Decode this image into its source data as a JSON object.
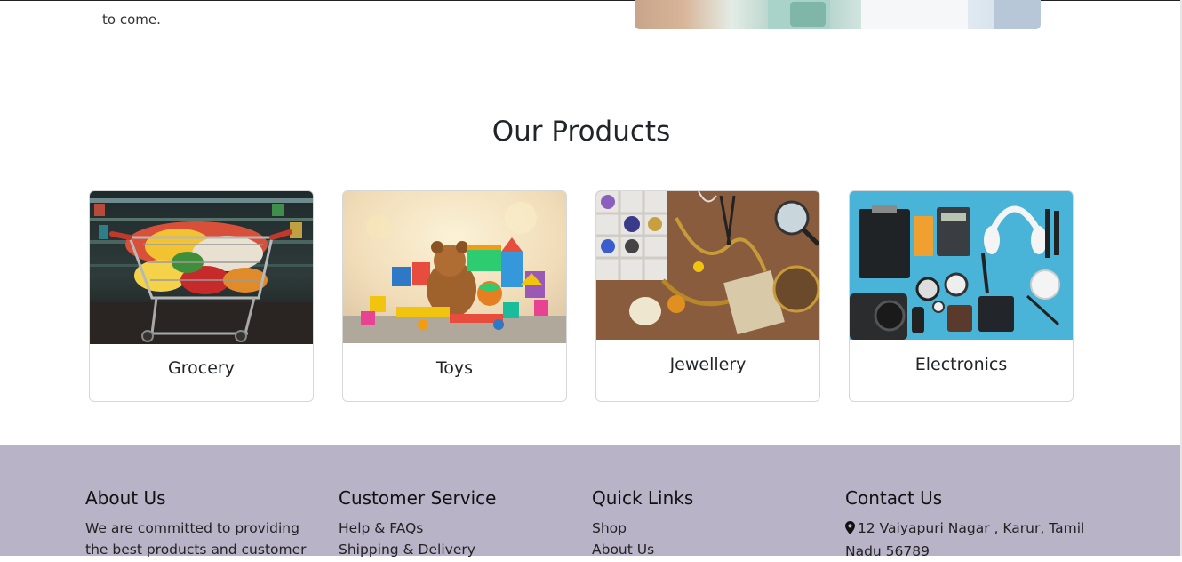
{
  "about": {
    "text_partial": "to come."
  },
  "products": {
    "title": "Our Products",
    "items": [
      {
        "label": "Grocery",
        "icon": "shopping-cart-image"
      },
      {
        "label": "Toys",
        "icon": "toys-image"
      },
      {
        "label": "Jewellery",
        "icon": "jewellery-image"
      },
      {
        "label": "Electronics",
        "icon": "electronics-image"
      }
    ]
  },
  "footer": {
    "about": {
      "title": "About Us",
      "text": "We are committed to providing the best products and customer"
    },
    "customer_service": {
      "title": "Customer Service",
      "links": [
        "Help & FAQs",
        "Shipping & Delivery"
      ]
    },
    "quick_links": {
      "title": "Quick Links",
      "links": [
        "Shop",
        "About Us"
      ]
    },
    "contact": {
      "title": "Contact Us",
      "address": "12 Vaiyapuri Nagar , Karur, Tamil Nadu 56789",
      "icon": "map-marker-icon"
    },
    "background": "#b9b3c8"
  }
}
